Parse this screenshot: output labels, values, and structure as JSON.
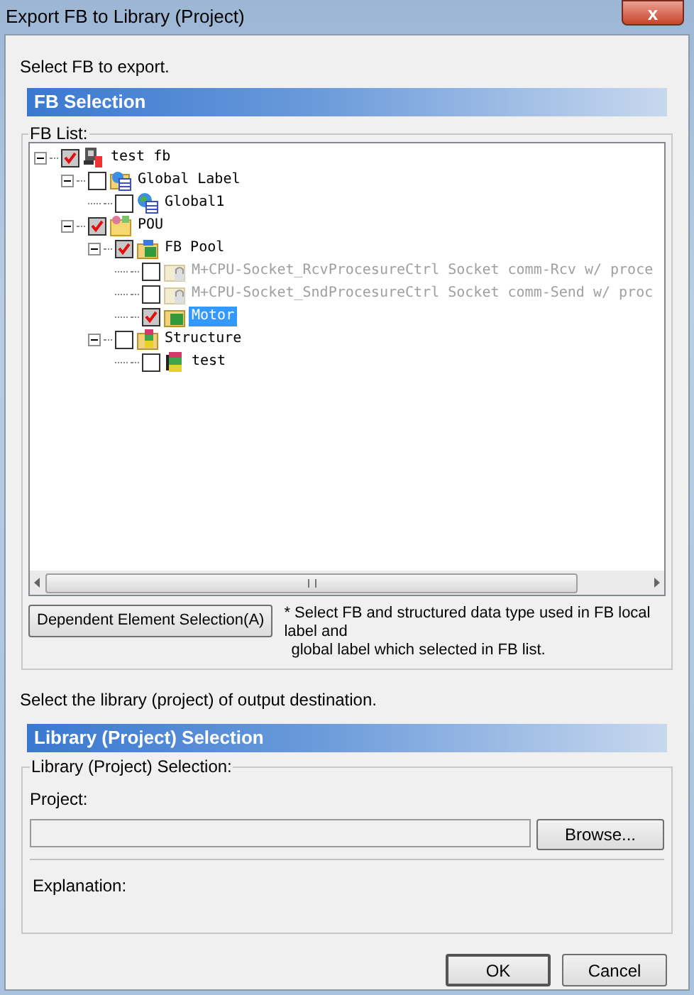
{
  "window": {
    "title": "Export FB to Library (Project)",
    "close": "x"
  },
  "intro": "Select FB to export.",
  "fb_section": {
    "title": "FB Selection",
    "group_label": "FB List:",
    "tree": [
      {
        "label": "test fb",
        "kind": "project",
        "checked": true,
        "expanded": true,
        "disabled": false,
        "selected": false,
        "children": [
          {
            "label": "Global Label",
            "kind": "label-group",
            "checked": false,
            "expanded": true,
            "disabled": false,
            "selected": false,
            "children": [
              {
                "label": "Global1",
                "kind": "label",
                "checked": false,
                "disabled": false,
                "selected": false
              }
            ]
          },
          {
            "label": "POU",
            "kind": "pou",
            "checked": true,
            "expanded": true,
            "disabled": false,
            "selected": false,
            "children": [
              {
                "label": "FB Pool",
                "kind": "fb-pool",
                "checked": true,
                "expanded": true,
                "disabled": false,
                "selected": false,
                "children": [
                  {
                    "label": "M+CPU-Socket_RcvProcesureCtrl Socket comm-Rcv w/ proce",
                    "kind": "library-fb",
                    "checked": false,
                    "disabled": true,
                    "selected": false
                  },
                  {
                    "label": "M+CPU-Socket_SndProcesureCtrl Socket comm-Send w/ proc",
                    "kind": "library-fb",
                    "checked": false,
                    "disabled": true,
                    "selected": false
                  },
                  {
                    "label": "Motor",
                    "kind": "fb",
                    "checked": true,
                    "disabled": false,
                    "selected": true
                  }
                ]
              },
              {
                "label": "Structure",
                "kind": "structure-group",
                "checked": false,
                "expanded": true,
                "disabled": false,
                "selected": false,
                "children": [
                  {
                    "label": "test",
                    "kind": "structure",
                    "checked": false,
                    "disabled": false,
                    "selected": false
                  }
                ]
              }
            ]
          }
        ]
      }
    ],
    "dependent_button": "Dependent Element Selection(A)",
    "note_lines": [
      "* Select FB and structured data type used in FB local label and",
      "global label which selected in FB list."
    ]
  },
  "output_prompt": "Select the library (project) of output destination.",
  "library_section": {
    "title": "Library (Project) Selection",
    "group_label": "Library (Project) Selection:",
    "project_label": "Project:",
    "browse_button": "Browse...",
    "explanation_label": "Explanation:"
  },
  "buttons": [
    "OK",
    "Cancel"
  ]
}
